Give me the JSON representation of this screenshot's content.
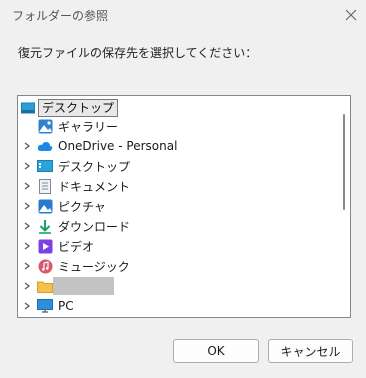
{
  "window": {
    "title": "フォルダーの参照"
  },
  "prompt": "復元ファイルの保存先を選択してください：",
  "tree": {
    "root_label": "デスクトップ",
    "items": [
      {
        "label": "ギャラリー",
        "icon": "gallery-icon",
        "expandable": false
      },
      {
        "label": "OneDrive - Personal",
        "icon": "onedrive-cloud-icon",
        "expandable": true
      },
      {
        "label": "デスクトップ",
        "icon": "desktop-folder-icon",
        "expandable": true
      },
      {
        "label": "ドキュメント",
        "icon": "documents-icon",
        "expandable": true
      },
      {
        "label": "ピクチャ",
        "icon": "pictures-icon",
        "expandable": true
      },
      {
        "label": "ダウンロード",
        "icon": "downloads-icon",
        "expandable": true
      },
      {
        "label": "ビデオ",
        "icon": "videos-icon",
        "expandable": true
      },
      {
        "label": "ミュージック",
        "icon": "music-icon",
        "expandable": true
      },
      {
        "label": "",
        "icon": "folder-icon",
        "expandable": true
      },
      {
        "label": "PC",
        "icon": "pc-icon",
        "expandable": true
      }
    ]
  },
  "buttons": {
    "ok": "OK",
    "cancel": "キャンセル"
  },
  "colors": {
    "background": "#f0f0f0",
    "tree_border": "#828790",
    "selected_bg": "#e8e8e8",
    "button_border": "#adadad"
  }
}
